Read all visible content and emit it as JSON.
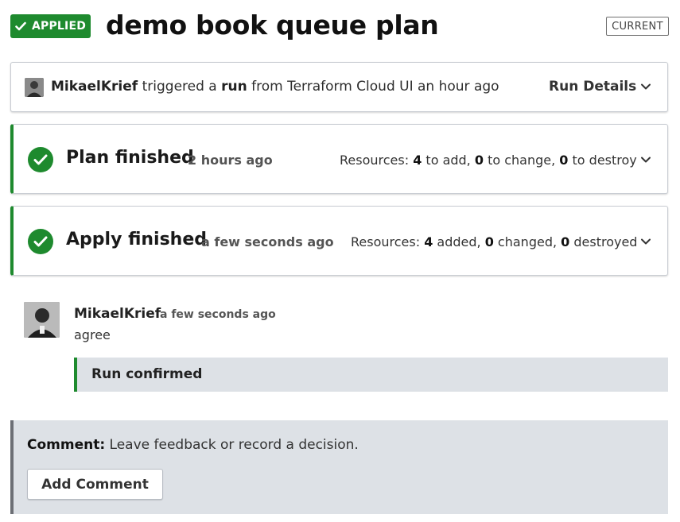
{
  "header": {
    "status": "APPLIED",
    "title": "demo book queue plan",
    "current_label": "CURRENT"
  },
  "run": {
    "user": "MikaelKrief",
    "text_triggered": " triggered a ",
    "text_run": "run",
    "text_from": " from Terraform Cloud UI an hour ago",
    "details_label": "Run Details"
  },
  "plan": {
    "title": "Plan finished",
    "time": "2 hours ago",
    "resources_label": "Resources: ",
    "add": "4",
    "add_label": " to add, ",
    "change": "0",
    "change_label": " to change, ",
    "destroy": "0",
    "destroy_label": " to destroy"
  },
  "apply": {
    "title": "Apply finished",
    "time": "a few seconds ago",
    "resources_label": "Resources: ",
    "added": "4",
    "added_label": " added, ",
    "changed": "0",
    "changed_label": " changed, ",
    "destroyed": "0",
    "destroyed_label": " destroyed"
  },
  "comment": {
    "author": "MikaelKrief",
    "time": "a few seconds ago",
    "body": "agree",
    "confirmation": "Run confirmed"
  },
  "comment_form": {
    "prompt_label": "Comment:",
    "prompt_text": " Leave feedback or record a decision.",
    "button_label": "Add Comment"
  },
  "colors": {
    "success": "#1e8a2e",
    "panel_bg": "#dde1e6"
  },
  "icons": {
    "badge": "check-icon",
    "stage": "check-circle-icon",
    "expand": "chevron-down-icon"
  }
}
